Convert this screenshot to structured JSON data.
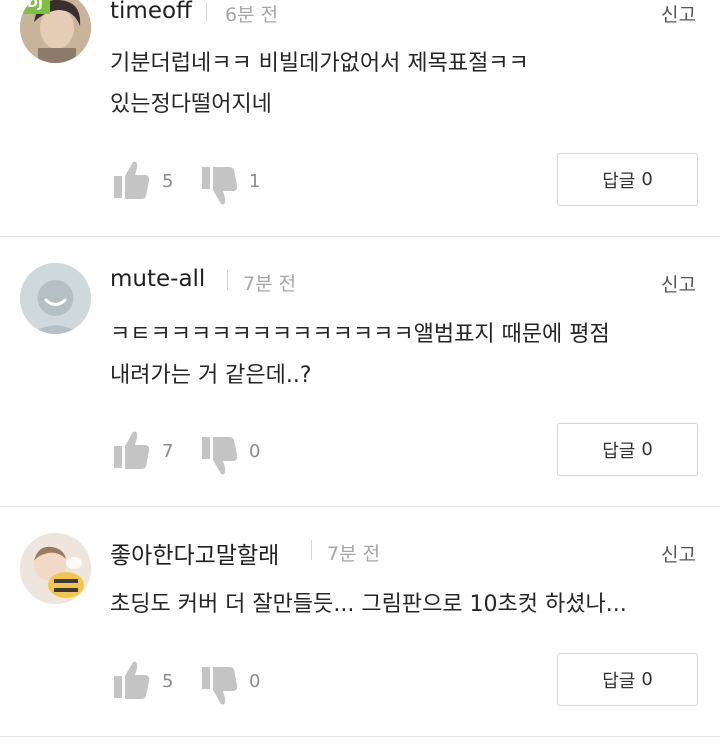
{
  "comments": [
    {
      "author": "timeoff",
      "time": "6분 전",
      "report": "신고",
      "badge": "DJ",
      "text_lines": [
        "기분더럽네ㅋㅋ 비빌데가없어서 제목표절ㅋㅋ",
        "있는정다떨어지네"
      ],
      "likes": "5",
      "dislikes": "1",
      "reply_label": "답글",
      "reply_count": "0"
    },
    {
      "author": "mute-all",
      "time": "7분 전",
      "report": "신고",
      "text_lines": [
        "ㅋㅌㅋㅋㅋㅋㅋㅋㅋㅋㅋㅋㅋㅋㅋ앨범표지 때문에 평점",
        "내려가는 거 같은데..?"
      ],
      "likes": "7",
      "dislikes": "0",
      "reply_label": "답글",
      "reply_count": "0"
    },
    {
      "author": "좋아한다고말할래",
      "time": "7분 전",
      "report": "신고",
      "text_lines": [
        "초딩도 커버 더 잘만들듯... 그림판으로 10초컷 하셨나..."
      ],
      "likes": "5",
      "dislikes": "0",
      "reply_label": "답글",
      "reply_count": "0"
    }
  ],
  "colors": {
    "thumb": "#c4c4c4",
    "badge": "#7cc042",
    "default_avatar_bg": "#cfd8db"
  },
  "icons": [
    "like-thumb-up-icon",
    "dislike-thumb-down-icon",
    "default-user-avatar-icon"
  ]
}
